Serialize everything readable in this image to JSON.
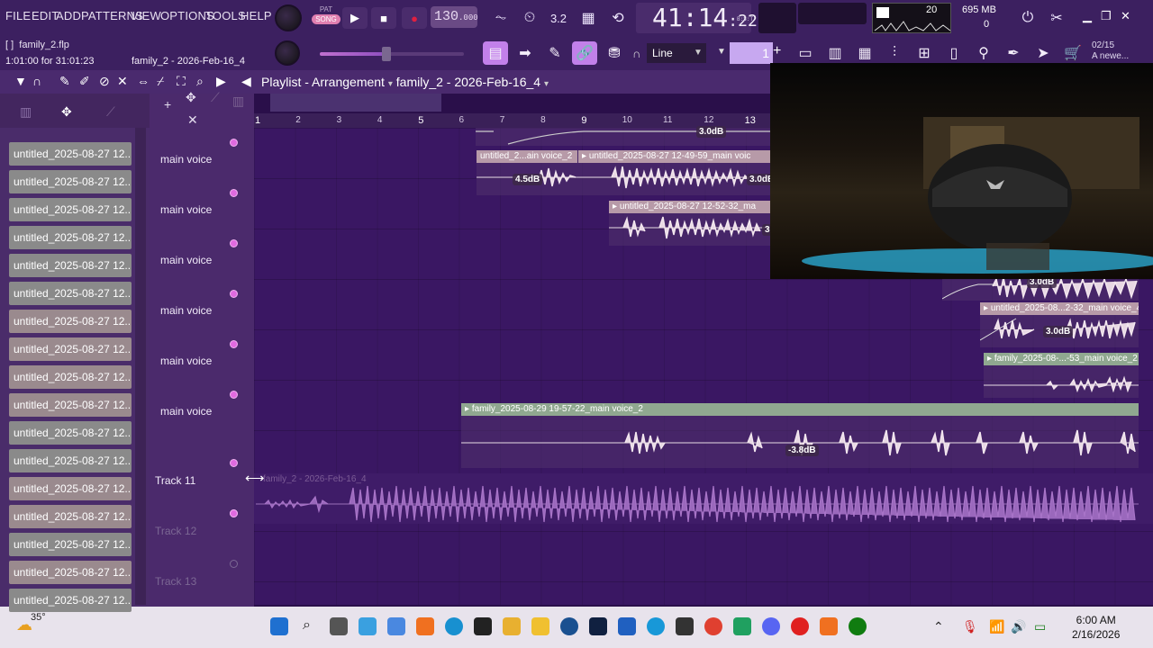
{
  "menu": [
    "FILE",
    "EDIT",
    "ADD",
    "PATTERNS",
    "VIEW",
    "OPTIONS",
    "TOOLS",
    "HELP"
  ],
  "transport": {
    "pat_label": "PAT",
    "song_label": "SONG",
    "tempo_main": "130",
    "tempo_dec": ".000",
    "time_main": "41:14",
    "time_sec": ":22",
    "time_format": "B:S:T"
  },
  "cpu": {
    "memory": "695 MB",
    "polyphony": "20",
    "zero": "0"
  },
  "file": {
    "name": "family_2.flp",
    "hint": "1:01:00 for 31:01:23",
    "project": "family_2 - 2026-Feb-16_4"
  },
  "snap": {
    "value": "Line",
    "pattern_num": "1"
  },
  "news": {
    "date": "02/15",
    "text": "A newe..."
  },
  "playlist": {
    "title": "Playlist - Arrangement",
    "project": "family_2 - 2026-Feb-16_4"
  },
  "ruler": [
    "1",
    "2",
    "3",
    "4",
    "5",
    "6",
    "7",
    "8",
    "9",
    "10",
    "11",
    "12",
    "13"
  ],
  "browser_items": [
    "untitled_2025-08-27 12...",
    "untitled_2025-08-27 12...",
    "untitled_2025-08-27 12...",
    "untitled_2025-08-27 12...",
    "untitled_2025-08-27 12...",
    "untitled_2025-08-27 12...",
    "untitled_2025-08-27 12...",
    "untitled_2025-08-27 12...",
    "untitled_2025-08-27 12...",
    "untitled_2025-08-27 12...",
    "untitled_2025-08-27 12...",
    "untitled_2025-08-27 12...",
    "untitled_2025-08-27 12...",
    "untitled_2025-08-27 12...",
    "untitled_2025-08-27 12...",
    "untitled_2025-08-27 12...",
    "untitled_2025-08-27 12..."
  ],
  "tracks": [
    {
      "name": "main voice"
    },
    {
      "name": "main voice"
    },
    {
      "name": "main voice"
    },
    {
      "name": "main voice"
    },
    {
      "name": "main voice"
    },
    {
      "name": "main voice"
    },
    {
      "name": "Track 11"
    },
    {
      "name": "Track 12"
    },
    {
      "name": "Track 13"
    }
  ],
  "clips": {
    "c1a": "untitled_2...ain voice_2",
    "c1b": "untitled_2025-08-27 12-49-59_main voic",
    "c2": "untitled_2025-08-27 12-52-32_ma",
    "c4": "untitled_2025-08...2-32_main voice_4",
    "c5": "family_2025-08-...-53_main voice_2",
    "c6": "family_2025-08-29 19-57-22_main voice_2",
    "c7": "family_2 - 2026-Feb-16_4",
    "db_top": "3.0dB",
    "db_1a": "4.5dB",
    "db_1b": "3.0dB",
    "db_2": "3",
    "db_3": "3.0dB",
    "db_4": "3.0dB",
    "db_6": "-3.8dB"
  },
  "taskbar": {
    "weather": "35°",
    "time": "6:00 AM",
    "date": "2/16/2026"
  },
  "colors": {
    "accent": "#c280ea",
    "background": "#3a1763",
    "clip_header_pink": "#b79aa8",
    "clip_header_green": "#90a890"
  }
}
